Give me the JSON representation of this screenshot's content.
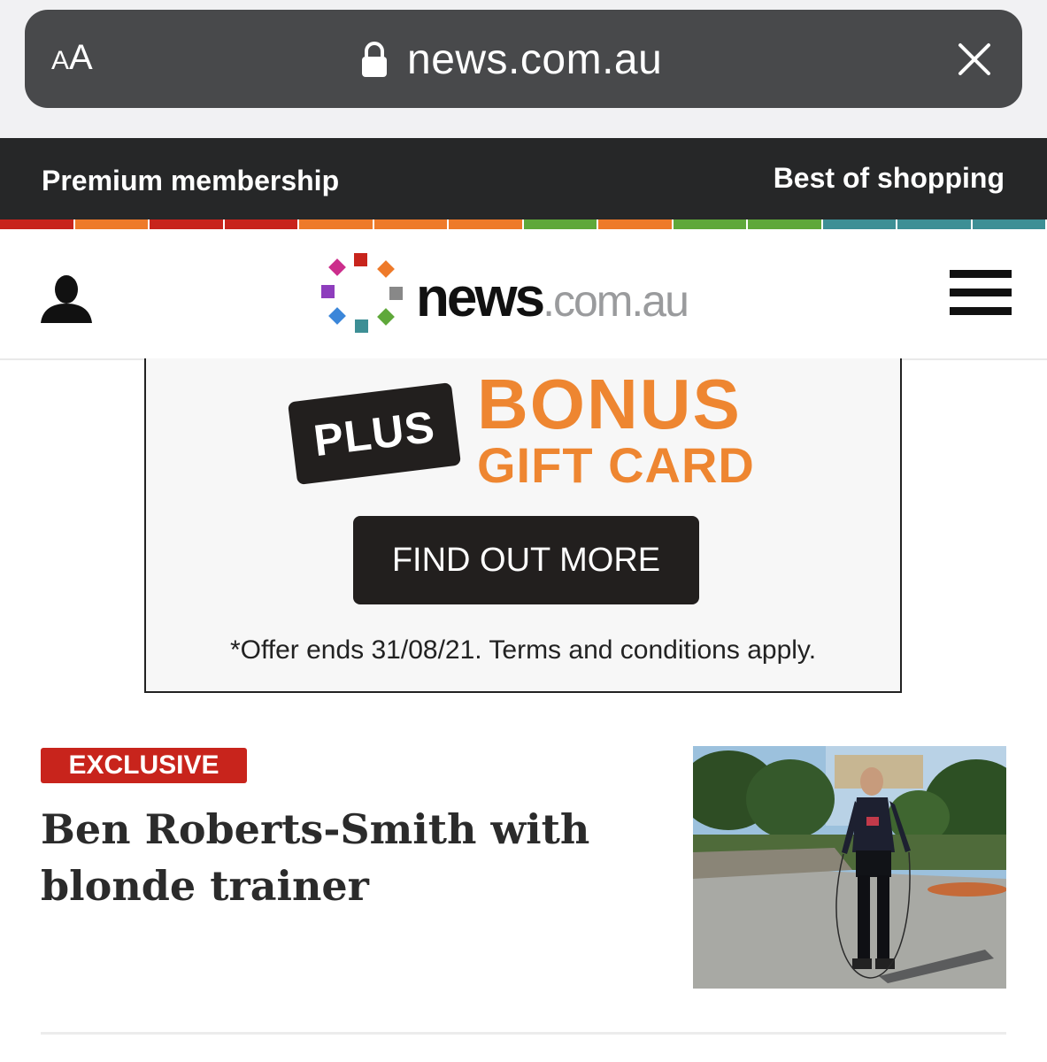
{
  "browser": {
    "text_size_small": "A",
    "text_size_large": "A",
    "url": "news.com.au"
  },
  "topnav": {
    "left_link": "Premium membership",
    "right_link": "Best of shopping",
    "stripe_colors": [
      "#c8241c",
      "#ee7a2a",
      "#c8241c",
      "#c8241c",
      "#ee7a2a",
      "#ee7a2a",
      "#ee7a2a",
      "#5fa83a",
      "#ee7a2a",
      "#5fa83a",
      "#5fa83a",
      "#3d8f95",
      "#3d8f95",
      "#3d8f95"
    ]
  },
  "header": {
    "logo_main": "news",
    "logo_domain": ".com.au"
  },
  "ad": {
    "plus_label": "PLUS",
    "bonus_label": "BONUS",
    "gift_label": "GIFT CARD",
    "cta_label": "FIND OUT MORE",
    "terms": "*Offer ends 31/08/21. Terms and conditions apply.",
    "accent_color": "#ee8631"
  },
  "article": {
    "badge": "EXCLUSIVE",
    "badge_color": "#c8241c",
    "headline": "Ben Roberts-Smith with blonde trainer"
  }
}
